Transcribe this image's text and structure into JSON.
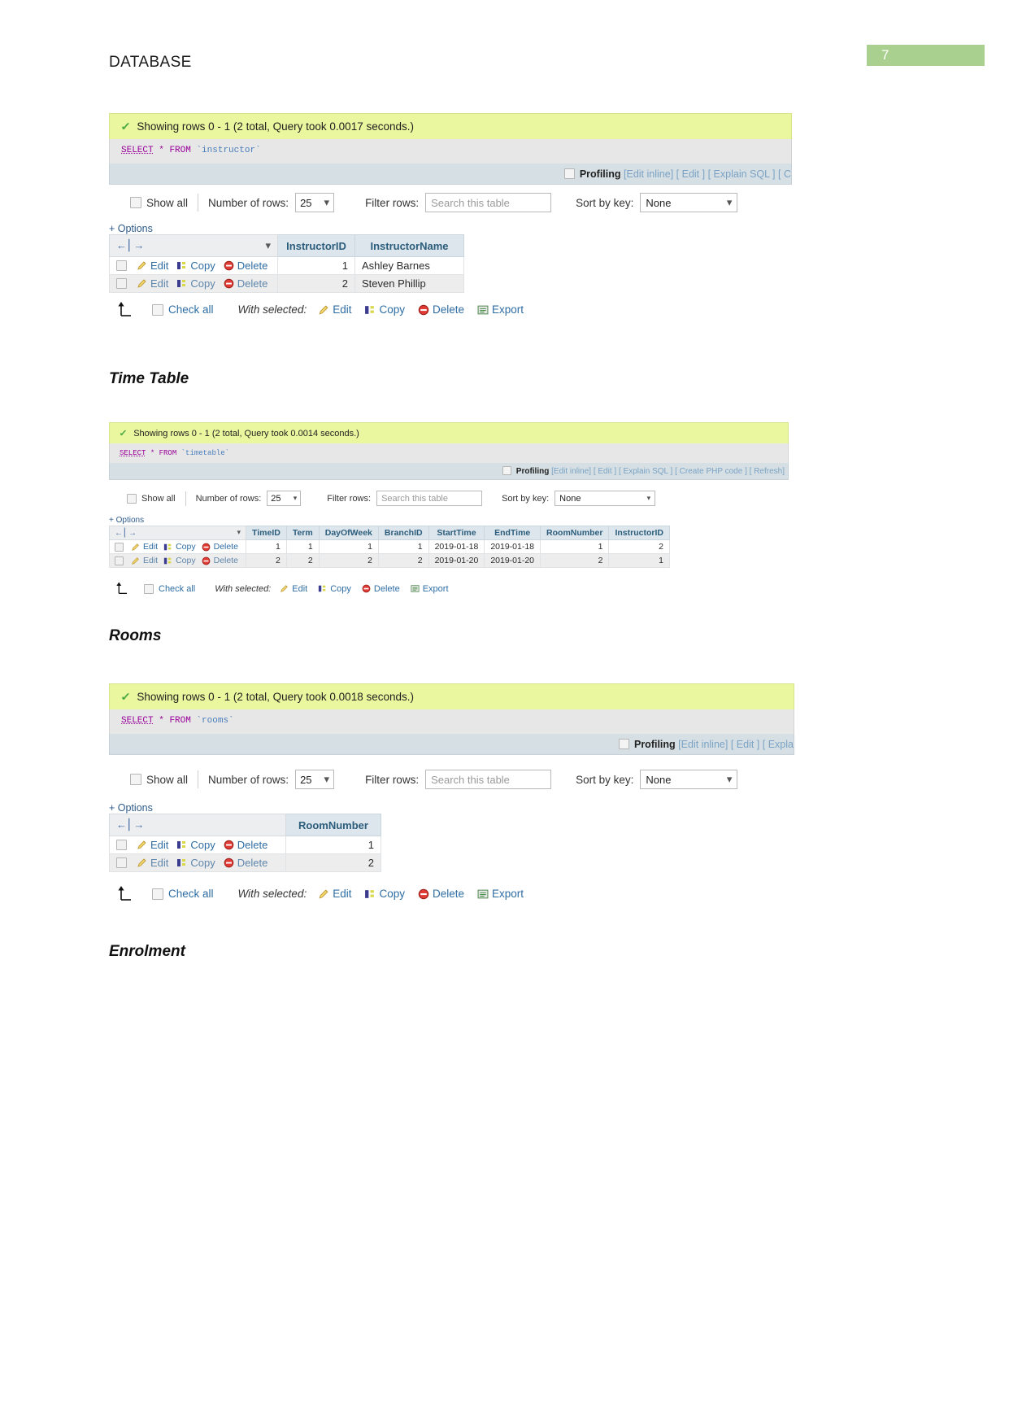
{
  "page": {
    "number": "7",
    "doc_title": "DATABASE",
    "chip_color": "#a9d08e"
  },
  "sections": [
    {
      "id": "instructor",
      "heading": "",
      "success_message": "Showing rows 0 - 1 (2 total, Query took 0.0017 seconds.)",
      "sql": {
        "keyword": "SELECT",
        "star": "*",
        "from": "FROM",
        "table": "`instructor`"
      },
      "profiling": {
        "label": "Profiling",
        "links": [
          "Edit inline",
          "Edit",
          "Explain SQL",
          "C"
        ]
      },
      "controls": {
        "show_all": "Show all",
        "number_of_rows_label": "Number of rows:",
        "number_of_rows_value": "25",
        "filter_label": "Filter rows:",
        "filter_placeholder": "Search this table",
        "sort_label": "Sort by key:",
        "sort_value": "None"
      },
      "options_label": "+ Options",
      "row_actions": {
        "edit": "Edit",
        "copy": "Copy",
        "delete": "Delete"
      },
      "columns": [
        "InstructorID",
        "InstructorName"
      ],
      "rows": [
        [
          "1",
          "Ashley Barnes"
        ],
        [
          "2",
          "Steven Phillip"
        ]
      ],
      "footer": {
        "check_all": "Check all",
        "with_selected": "With selected:",
        "edit": "Edit",
        "copy": "Copy",
        "delete": "Delete",
        "export": "Export"
      }
    },
    {
      "id": "timetable",
      "heading": "Time Table",
      "success_message": "Showing rows 0 - 1 (2 total, Query took 0.0014 seconds.)",
      "sql": {
        "keyword": "SELECT",
        "star": "*",
        "from": "FROM",
        "table": "`timetable`"
      },
      "profiling": {
        "label": "Profiling",
        "links": [
          "Edit inline",
          "Edit",
          "Explain SQL",
          "Create PHP code",
          "Refresh"
        ]
      },
      "controls": {
        "show_all": "Show all",
        "number_of_rows_label": "Number of rows:",
        "number_of_rows_value": "25",
        "filter_label": "Filter rows:",
        "filter_placeholder": "Search this table",
        "sort_label": "Sort by key:",
        "sort_value": "None"
      },
      "options_label": "+ Options",
      "row_actions": {
        "edit": "Edit",
        "copy": "Copy",
        "delete": "Delete"
      },
      "columns": [
        "TimeID",
        "Term",
        "DayOfWeek",
        "BranchID",
        "StartTime",
        "EndTime",
        "RoomNumber",
        "InstructorID"
      ],
      "rows": [
        [
          "1",
          "1",
          "1",
          "1",
          "2019-01-18",
          "2019-01-18",
          "1",
          "2"
        ],
        [
          "2",
          "2",
          "2",
          "2",
          "2019-01-20",
          "2019-01-20",
          "2",
          "1"
        ]
      ],
      "footer": {
        "check_all": "Check all",
        "with_selected": "With selected:",
        "edit": "Edit",
        "copy": "Copy",
        "delete": "Delete",
        "export": "Export"
      }
    },
    {
      "id": "rooms",
      "heading": "Rooms",
      "success_message": "Showing rows 0 - 1 (2 total, Query took 0.0018 seconds.)",
      "sql": {
        "keyword": "SELECT",
        "star": "*",
        "from": "FROM",
        "table": "`rooms`"
      },
      "profiling": {
        "label": "Profiling",
        "links": [
          "Edit inline",
          "Edit",
          "Expla"
        ]
      },
      "controls": {
        "show_all": "Show all",
        "number_of_rows_label": "Number of rows:",
        "number_of_rows_value": "25",
        "filter_label": "Filter rows:",
        "filter_placeholder": "Search this table",
        "sort_label": "Sort by key:",
        "sort_value": "None"
      },
      "options_label": "+ Options",
      "row_actions": {
        "edit": "Edit",
        "copy": "Copy",
        "delete": "Delete"
      },
      "columns": [
        "RoomNumber"
      ],
      "rows": [
        [
          "1"
        ],
        [
          "2"
        ]
      ],
      "footer": {
        "check_all": "Check all",
        "with_selected": "With selected:",
        "edit": "Edit",
        "copy": "Copy",
        "delete": "Delete",
        "export": "Export"
      }
    }
  ],
  "trailing_heading": "Enrolment"
}
